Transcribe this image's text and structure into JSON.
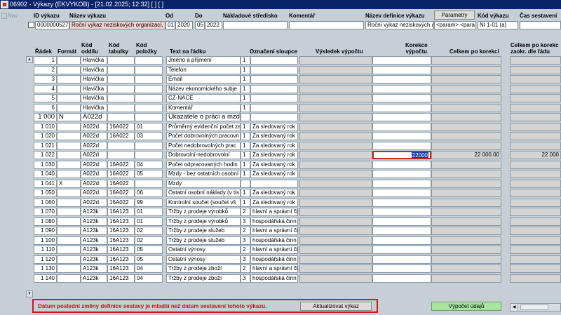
{
  "window": {
    "title": "06902 - Výkazy (EKVYKOB) - [21.02.2025; 12:32]  [ ]  [ ]"
  },
  "nav": {
    "label": "Nav"
  },
  "header": {
    "labels": {
      "id": "ID výkazu",
      "name": "Název výkazu",
      "from": "Od",
      "to": "Do",
      "cost_center": "Nákladové středisko",
      "comment": "Komentář",
      "def_name": "Název definice výkazu",
      "code": "Kód výkazu",
      "time": "Čas sestavení"
    },
    "params_button": "Parametry",
    "values": {
      "id": "0000000527",
      "name": "Roční výkaz neziskových organizací, b",
      "from_month": "01",
      "from_year": "2020",
      "to_month": "05",
      "to_year": "2022",
      "cost_center": "",
      "comment": "",
      "def_name": "Roční výkaz neziskových or",
      "params": "<param>  <para",
      "code": "NI 1-01 (a)",
      "time": ""
    }
  },
  "columns": {
    "radek": "Řádek",
    "format": "Formát",
    "kod_oddilu_1": "Kód",
    "kod_oddilu_2": "oddílu",
    "kod_tabulky_1": "Kód",
    "kod_tabulky_2": "tabulky",
    "kod_polozky_1": "Kód",
    "kod_polozky_2": "položky",
    "text": "Text na řádku",
    "oznaceni": "Označení sloupce",
    "vysledek": "Výsledek výpočtu",
    "korekce_1": "Korekce",
    "korekce_2": "výpočtu",
    "celkem": "Celkem po korekci",
    "zaokr_1": "Celkem po korekc",
    "zaokr_2": "zaokr. dle řádu"
  },
  "rows": [
    {
      "radek": "1",
      "format": "",
      "oddil": "Hlavička",
      "tabulka": "",
      "polozka": "",
      "text": "Jméno a příjmení",
      "sloupec": "1",
      "oznaceni": "",
      "vysledek": "",
      "korekce": "",
      "celkem": "",
      "zaokr": ""
    },
    {
      "radek": "2",
      "format": "",
      "oddil": "Hlavička",
      "tabulka": "",
      "polozka": "",
      "text": "Telefon",
      "sloupec": "1",
      "oznaceni": "",
      "vysledek": "",
      "korekce": "",
      "celkem": "",
      "zaokr": ""
    },
    {
      "radek": "3",
      "format": "",
      "oddil": "Hlavička",
      "tabulka": "",
      "polozka": "",
      "text": "Email",
      "sloupec": "1",
      "oznaceni": "",
      "vysledek": "",
      "korekce": "",
      "celkem": "",
      "zaokr": ""
    },
    {
      "radek": "4",
      "format": "",
      "oddil": "Hlavička",
      "tabulka": "",
      "polozka": "",
      "text": "Název ekonomického subje",
      "sloupec": "1",
      "oznaceni": "",
      "vysledek": "",
      "korekce": "",
      "celkem": "",
      "zaokr": ""
    },
    {
      "radek": "5",
      "format": "",
      "oddil": "Hlavička",
      "tabulka": "",
      "polozka": "",
      "text": "CZ-NACE",
      "sloupec": "1",
      "oznaceni": "",
      "vysledek": "",
      "korekce": "",
      "celkem": "",
      "zaokr": ""
    },
    {
      "radek": "6",
      "format": "",
      "oddil": "Hlavička",
      "tabulka": "",
      "polozka": "",
      "text": "Komentář",
      "sloupec": "1",
      "oznaceni": "",
      "vysledek": "",
      "korekce": "",
      "celkem": "",
      "zaokr": ""
    },
    {
      "radek": "1 000",
      "format": "N",
      "oddil": "A022d",
      "tabulka": "",
      "polozka": "",
      "text": "Ukazatele o práci a mzd",
      "sloupec": "",
      "oznaceni": "",
      "vysledek": "",
      "korekce": "",
      "celkem": "",
      "zaokr": "",
      "big": true
    },
    {
      "radek": "1 010",
      "format": "",
      "oddil": "A022d",
      "tabulka": "16A022",
      "polozka": "01",
      "text": "Průměrný evidenční počet za",
      "sloupec": "1",
      "oznaceni": "Za sledovaný rok",
      "vysledek": "",
      "korekce": "",
      "celkem": "",
      "zaokr": ""
    },
    {
      "radek": "1 020",
      "format": "",
      "oddil": "A022d",
      "tabulka": "16A022",
      "polozka": "03",
      "text": "Počet dobrovolných pracovn",
      "sloupec": "1",
      "oznaceni": "Za sledovaný rok",
      "vysledek": "",
      "korekce": "",
      "celkem": "",
      "zaokr": ""
    },
    {
      "radek": "1 021",
      "format": "",
      "oddil": "A022d",
      "tabulka": "",
      "polozka": "",
      "text": "Počet nedobrovolných prac",
      "sloupec": "1",
      "oznaceni": "Za sledovaný rok",
      "vysledek": "",
      "korekce": "",
      "celkem": "",
      "zaokr": ""
    },
    {
      "radek": "1 022",
      "format": "",
      "oddil": "A022d",
      "tabulka": "",
      "polozka": "",
      "text": "Dobrovolní-nedobrovolní",
      "sloupec": "1",
      "oznaceni": "Za sledovaný rok",
      "vysledek": "",
      "korekce": "22000",
      "celkem": "22 000.00",
      "zaokr": "22 000",
      "selected": true
    },
    {
      "radek": "1 030",
      "format": "",
      "oddil": "A022d",
      "tabulka": "16A022",
      "polozka": "04",
      "text": "Počet odpracovaných hodin",
      "sloupec": "1",
      "oznaceni": "Za sledovaný rok",
      "vysledek": "",
      "korekce": "",
      "celkem": "",
      "zaokr": ""
    },
    {
      "radek": "1 040",
      "format": "",
      "oddil": "A022d",
      "tabulka": "16A022",
      "polozka": "05",
      "text": "Mzdy - bez ostatních osobní",
      "sloupec": "1",
      "oznaceni": "Za sledovaný rok",
      "vysledek": "",
      "korekce": "",
      "celkem": "",
      "zaokr": ""
    },
    {
      "radek": "1 041",
      "format": "X",
      "oddil": "A022d",
      "tabulka": "16A022",
      "polozka": "",
      "text": "Mzdy",
      "sloupec": "",
      "oznaceni": "",
      "vysledek": "",
      "korekce": "",
      "celkem": "",
      "zaokr": ""
    },
    {
      "radek": "1 050",
      "format": "",
      "oddil": "A022d",
      "tabulka": "16A022",
      "polozka": "06",
      "text": "Ostatní osobní náklady (v tis",
      "sloupec": "1",
      "oznaceni": "Za sledovaný rok",
      "vysledek": "",
      "korekce": "",
      "celkem": "",
      "zaokr": ""
    },
    {
      "radek": "1 060",
      "format": "",
      "oddil": "A022d",
      "tabulka": "16A022",
      "polozka": "99",
      "text": "Kontrolní součet (součet vš",
      "sloupec": "1",
      "oznaceni": "Za sledovaný rok",
      "vysledek": "",
      "korekce": "",
      "celkem": "",
      "zaokr": ""
    },
    {
      "radek": "1 070",
      "format": "",
      "oddil": "A123k",
      "tabulka": "16A123",
      "polozka": "01",
      "text": "Tržby z prodeje výrobků",
      "sloupec": "2",
      "oznaceni": "hlavní a správní či",
      "vysledek": "",
      "korekce": "",
      "celkem": "",
      "zaokr": ""
    },
    {
      "radek": "1 080",
      "format": "",
      "oddil": "A123k",
      "tabulka": "16A123",
      "polozka": "01",
      "text": "Tržby z prodeje výrobků",
      "sloupec": "3",
      "oznaceni": "hospodářská činn",
      "vysledek": "",
      "korekce": "",
      "celkem": "",
      "zaokr": ""
    },
    {
      "radek": "1 090",
      "format": "",
      "oddil": "A123k",
      "tabulka": "16A123",
      "polozka": "02",
      "text": "Tržby z prodeje služeb",
      "sloupec": "2",
      "oznaceni": "hlavní a správní či",
      "vysledek": "",
      "korekce": "",
      "celkem": "",
      "zaokr": ""
    },
    {
      "radek": "1 100",
      "format": "",
      "oddil": "A123k",
      "tabulka": "16A123",
      "polozka": "02",
      "text": "Tržby z prodeje služeb",
      "sloupec": "3",
      "oznaceni": "hospodářská činn",
      "vysledek": "",
      "korekce": "",
      "celkem": "",
      "zaokr": ""
    },
    {
      "radek": "1 110",
      "format": "",
      "oddil": "A123k",
      "tabulka": "16A123",
      "polozka": "05",
      "text": "Ostatní výnosy",
      "sloupec": "2",
      "oznaceni": "hlavní a správní či",
      "vysledek": "",
      "korekce": "",
      "celkem": "",
      "zaokr": ""
    },
    {
      "radek": "1 120",
      "format": "",
      "oddil": "A123k",
      "tabulka": "16A123",
      "polozka": "05",
      "text": "Ostatní výnosy",
      "sloupec": "3",
      "oznaceni": "hospodářská činn",
      "vysledek": "",
      "korekce": "",
      "celkem": "",
      "zaokr": ""
    },
    {
      "radek": "1 130",
      "format": "",
      "oddil": "A123k",
      "tabulka": "16A123",
      "polozka": "04",
      "text": "Tržby z prodeje zboží",
      "sloupec": "2",
      "oznaceni": "hlavní a správní či",
      "vysledek": "",
      "korekce": "",
      "celkem": "",
      "zaokr": ""
    },
    {
      "radek": "1 140",
      "format": "",
      "oddil": "A123k",
      "tabulka": "16A123",
      "polozka": "04",
      "text": "Tržby z prodeje zboží",
      "sloupec": "3",
      "oznaceni": "hospodářská činn",
      "vysledek": "",
      "korekce": "",
      "celkem": "",
      "zaokr": ""
    }
  ],
  "footer": {
    "warning": "Datum poslední změny definice sestavy je mladší než datum sestavení tohoto výkazu.",
    "update_button": "Aktualizovat výkaz",
    "calc_button": "Výpočet údajů"
  },
  "colors": {
    "calc_button": "#a8e6a0",
    "warning": "#d01010",
    "titlebar": "#0a246a",
    "pink_field": "#f6d2d2"
  }
}
